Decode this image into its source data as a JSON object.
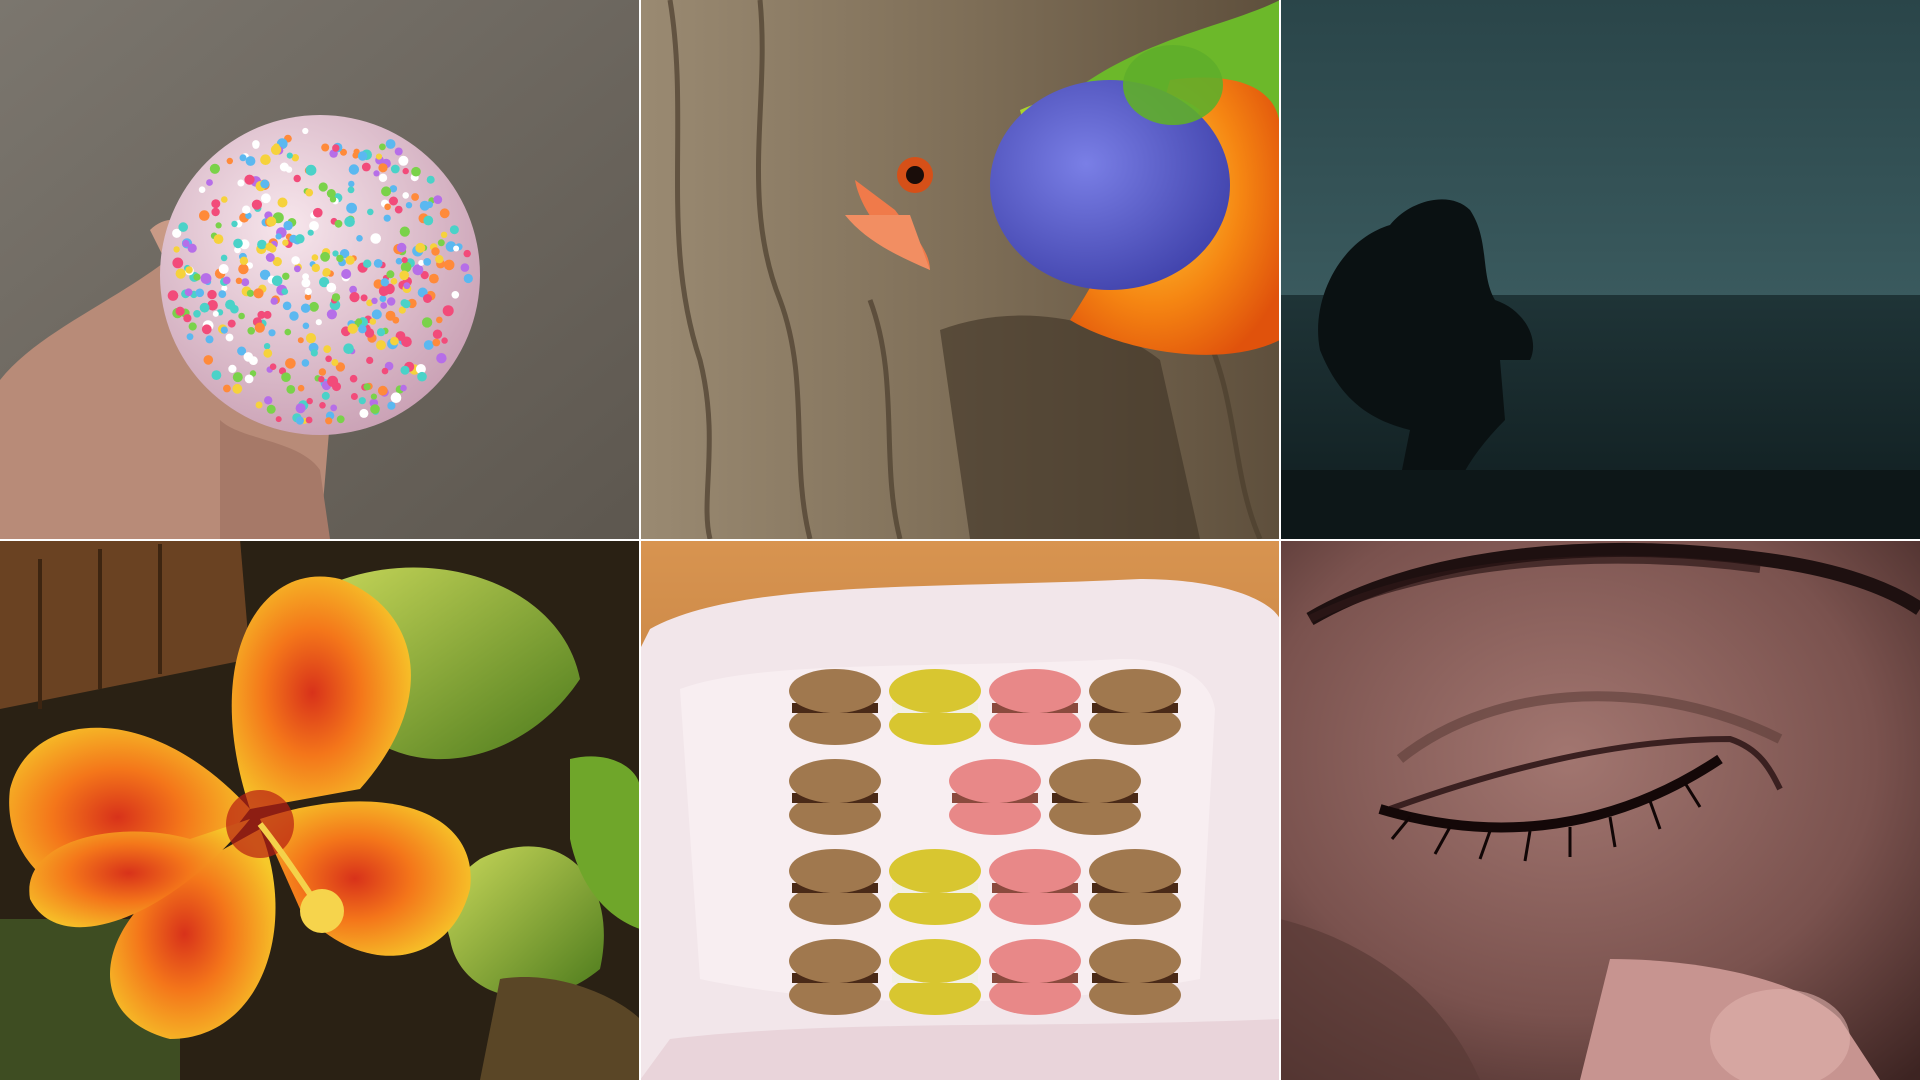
{
  "layout": "collage-3x2",
  "tiles": [
    {
      "subject": "sprinkle-cake-pop-in-hand",
      "colors": {
        "bg": "#6f6a62",
        "hand": "#c79a86"
      }
    },
    {
      "subject": "rainbow-lorikeet-on-tree-trunk",
      "colors": {
        "bark": "#8c7a62",
        "head": "#5a5fd0",
        "breast": "#f07a10",
        "neck": "#7cc22a"
      }
    },
    {
      "subject": "silhouette-crouching-by-sea",
      "colors": {
        "sky": "#2d4a4e",
        "sea": "#17282b"
      }
    },
    {
      "subject": "orange-hibiscus-flower",
      "colors": {
        "petal": "#f57a1c",
        "petal_edge": "#f4c42a",
        "leaf": "#8fb028"
      }
    },
    {
      "subject": "macarons-in-paper-lined-box",
      "colors": {
        "paper": "#f3e4e8",
        "tray": "#c8823e"
      }
    },
    {
      "subject": "closed-eye-close-up",
      "colors": {
        "skin": "#7a5450",
        "shadow": "#3a2020"
      }
    }
  ]
}
